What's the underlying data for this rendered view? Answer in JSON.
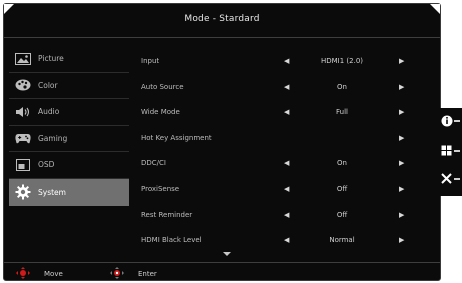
{
  "header": {
    "title": "Mode - Stardard"
  },
  "sidebar": {
    "items": [
      {
        "label": "Picture",
        "icon": "picture-icon"
      },
      {
        "label": "Color",
        "icon": "palette-icon"
      },
      {
        "label": "Audio",
        "icon": "speaker-icon"
      },
      {
        "label": "Gaming",
        "icon": "gamepad-icon"
      },
      {
        "label": "OSD",
        "icon": "osd-icon"
      },
      {
        "label": "System",
        "icon": "gear-icon",
        "active": true
      }
    ]
  },
  "settings": [
    {
      "label": "Input",
      "value": "HDMI1 (2.0)",
      "left_arrow": true,
      "right_arrow": true
    },
    {
      "label": "Auto Source",
      "value": "On",
      "left_arrow": true,
      "right_arrow": true
    },
    {
      "label": "Wide Mode",
      "value": "Full",
      "left_arrow": true,
      "right_arrow": true
    },
    {
      "label": "Hot Key Assignment",
      "value": "",
      "left_arrow": false,
      "right_arrow": true
    },
    {
      "label": "DDC/CI",
      "value": "On",
      "left_arrow": true,
      "right_arrow": true
    },
    {
      "label": "ProxiSense",
      "value": "Off",
      "left_arrow": true,
      "right_arrow": true
    },
    {
      "label": "Rest Reminder",
      "value": "Off",
      "left_arrow": true,
      "right_arrow": true
    },
    {
      "label": "HDMI Black Level",
      "value": "Normal",
      "left_arrow": true,
      "right_arrow": true
    }
  ],
  "footer": {
    "move_label": "Move",
    "enter_label": "Enter"
  },
  "side_buttons": [
    {
      "icon": "info-icon"
    },
    {
      "icon": "grid-icon"
    },
    {
      "icon": "close-icon"
    }
  ],
  "colors": {
    "background": "#0b0b0b",
    "active_item": "#707070",
    "accent_red": "#d11a1a"
  }
}
